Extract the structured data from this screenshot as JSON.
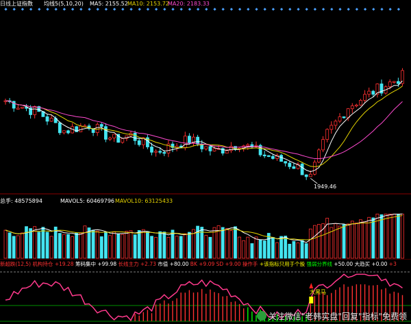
{
  "header": {
    "period": "日线",
    "index": "上证指数",
    "ma_setting": "均线5(5,10,20)",
    "ma5": "MA5: 2155.52",
    "ma10": "MA10: 2153.72",
    "ma20": "MA20: 2183.33"
  },
  "price_panel": {
    "low_label": "1949.46"
  },
  "volume_panel": {
    "vol_label": "总手: 48575894",
    "mavol5": "MAVOL5: 60469796",
    "mavol10": "MAVOL10: 63125433"
  },
  "indicator_panel": {
    "items": [
      {
        "text": "新超跌(12,5)",
        "color": "#ff3030"
      },
      {
        "text": "机构持仓",
        "color": "#ff3030"
      },
      {
        "text": "+19.28",
        "color": "#ff3030"
      },
      {
        "text": "筹码集中",
        "color": "#ffffff"
      },
      {
        "text": "+99.98",
        "color": "#ffffff"
      },
      {
        "text": "长线主力",
        "color": "#ff3030"
      },
      {
        "text": "+2.73",
        "color": "#ff3030"
      },
      {
        "text": "市值",
        "color": "#ffffff"
      },
      {
        "text": "+80.00",
        "color": "#ffffff"
      },
      {
        "text": "BK",
        "color": "#ff3030"
      },
      {
        "text": "+9.09",
        "color": "#ff3030"
      },
      {
        "text": "SD",
        "color": "#ff3030"
      },
      {
        "text": "+9.00",
        "color": "#ff3030"
      },
      {
        "text": "操作手",
        "color": "#ff3030"
      },
      {
        "text": "+该指标只用于个股",
        "color": "#ffff00"
      },
      {
        "text": "强弱分界线",
        "color": "#00ff00"
      },
      {
        "text": "+50.00",
        "color": "#ffffff"
      },
      {
        "text": "大趋买",
        "color": "#ffffff"
      },
      {
        "text": "+0.00",
        "color": "#ffffff"
      },
      {
        "text": "+3",
        "color": "#ff3030"
      }
    ],
    "annotation": "大黑马"
  },
  "watermark": {
    "text": "关注微信\"老韩实盘\"回复\"指标\"免费领"
  },
  "colors": {
    "up": "#ff3030",
    "down": "#44e4f0",
    "ma5": "#ffffff",
    "ma10": "#e6d400",
    "ma20": "#ff4ad0"
  }
}
